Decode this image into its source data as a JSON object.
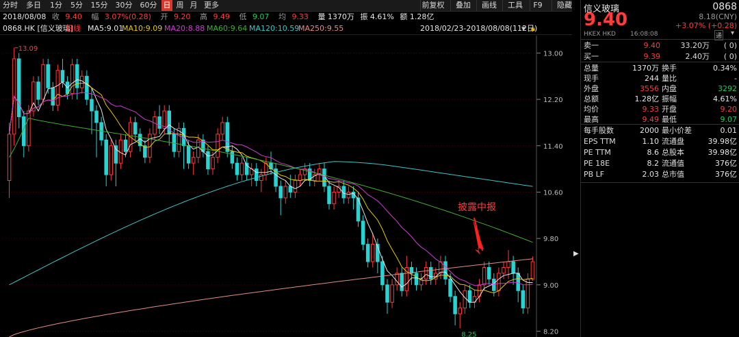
{
  "tabs": [
    "分时",
    "多日",
    "1分",
    "5分",
    "15分",
    "30分",
    "60分",
    "日",
    "周",
    "月",
    "更多"
  ],
  "active_tab": "日",
  "toolbar": [
    "前复权",
    "叠加",
    "画线",
    "工具",
    "F9",
    "隐藏"
  ],
  "info": {
    "date": "2018/08/08",
    "close_label": "收",
    "close": "9.40",
    "change_label": "幅",
    "change": "3.07%(0.28)",
    "open_label": "开",
    "open": "9.20",
    "high_label": "高",
    "high": "9.49",
    "low_label": "低",
    "low": "9.07",
    "avg_label": "均",
    "avg": "9.33",
    "volume": "量 1370万",
    "amplitude": "振 4.61%",
    "amount": "额 1.28亿"
  },
  "ma_bar": {
    "code": "0868.HK [信义玻璃]",
    "period": "日线",
    "ma5": "MA5:9.01",
    "ma10": "MA10:9.09",
    "ma20": "MA20:8.88",
    "ma60": "MA60:9.64",
    "ma120": "MA120:10.59",
    "ma250": "MA250:9.55",
    "range": "2018/02/23-2018/08/08(112日)"
  },
  "colors": {
    "up": "#ff3b3b",
    "down": "#27d3d3",
    "ma5": "#e6e6e6",
    "ma10": "#e8c800",
    "ma20": "#d13ad1",
    "ma60": "#3fae2f",
    "ma120": "#3cc6c6",
    "ma250": "#e28e86"
  },
  "annotation": "披露中报",
  "high_mark": "13.09",
  "low_mark": "8.25",
  "chart_data": {
    "type": "candlestick",
    "y_ticks": [
      "13.00",
      "12.20",
      "11.40",
      "10.60",
      "9.80",
      "9.00",
      "8.20"
    ],
    "ylim": [
      8.1,
      13.3
    ],
    "candles": [
      [
        10.8,
        11.6,
        10.5,
        11.8
      ],
      [
        11.6,
        12.9,
        11.4,
        13.09
      ],
      [
        12.9,
        11.9,
        11.7,
        13.0
      ],
      [
        11.9,
        11.4,
        11.2,
        12.0
      ],
      [
        11.4,
        12.0,
        11.3,
        12.1
      ],
      [
        12.0,
        12.5,
        11.9,
        12.6
      ],
      [
        12.5,
        12.2,
        12.1,
        12.6
      ],
      [
        12.2,
        12.8,
        12.1,
        12.9
      ],
      [
        12.8,
        12.4,
        12.3,
        12.9
      ],
      [
        12.4,
        12.1,
        12.0,
        12.5
      ],
      [
        12.1,
        12.7,
        12.0,
        12.8
      ],
      [
        12.7,
        12.5,
        12.4,
        12.9
      ],
      [
        12.5,
        12.3,
        12.2,
        12.6
      ],
      [
        12.3,
        12.8,
        12.2,
        12.9
      ],
      [
        12.8,
        12.4,
        12.2,
        12.9
      ],
      [
        12.4,
        12.6,
        12.3,
        12.7
      ],
      [
        12.6,
        12.2,
        12.1,
        12.7
      ],
      [
        12.2,
        12.0,
        11.6,
        12.4
      ],
      [
        12.0,
        11.8,
        11.2,
        12.1
      ],
      [
        11.8,
        11.5,
        11.4,
        11.9
      ],
      [
        11.5,
        10.9,
        10.7,
        11.6
      ],
      [
        10.9,
        11.4,
        10.8,
        11.5
      ],
      [
        11.4,
        11.1,
        10.7,
        11.5
      ],
      [
        11.1,
        11.5,
        11.0,
        11.6
      ],
      [
        11.5,
        11.3,
        11.2,
        11.6
      ],
      [
        11.3,
        11.8,
        11.2,
        11.9
      ],
      [
        11.8,
        11.6,
        11.5,
        11.9
      ],
      [
        11.6,
        11.4,
        11.3,
        11.7
      ],
      [
        11.4,
        11.2,
        11.1,
        11.5
      ],
      [
        11.2,
        11.6,
        11.1,
        11.7
      ],
      [
        11.6,
        11.9,
        11.5,
        12.0
      ],
      [
        11.9,
        11.7,
        11.6,
        12.1
      ],
      [
        11.7,
        12.0,
        11.6,
        12.1
      ],
      [
        12.0,
        11.6,
        11.4,
        12.1
      ],
      [
        11.6,
        11.3,
        11.2,
        11.7
      ],
      [
        11.3,
        11.7,
        11.2,
        11.8
      ],
      [
        11.7,
        11.4,
        11.0,
        11.8
      ],
      [
        11.4,
        11.1,
        11.0,
        11.5
      ],
      [
        11.1,
        11.2,
        10.9,
        11.3
      ],
      [
        11.2,
        11.5,
        11.1,
        11.6
      ],
      [
        11.5,
        11.3,
        11.2,
        11.6
      ],
      [
        11.3,
        11.0,
        10.9,
        11.4
      ],
      [
        11.0,
        11.2,
        10.9,
        11.3
      ],
      [
        11.2,
        11.6,
        11.1,
        11.7
      ],
      [
        11.6,
        11.8,
        11.5,
        11.9
      ],
      [
        11.8,
        11.3,
        11.2,
        11.9
      ],
      [
        11.3,
        11.1,
        11.0,
        11.4
      ],
      [
        11.1,
        10.9,
        10.8,
        11.2
      ],
      [
        10.9,
        11.1,
        10.8,
        11.2
      ],
      [
        11.1,
        10.9,
        10.8,
        11.2
      ],
      [
        10.9,
        11.0,
        10.7,
        11.1
      ],
      [
        11.0,
        10.8,
        10.7,
        11.1
      ],
      [
        10.8,
        10.9,
        10.6,
        11.0
      ],
      [
        10.9,
        11.1,
        10.8,
        11.2
      ],
      [
        11.1,
        11.0,
        10.9,
        11.3
      ],
      [
        11.0,
        10.7,
        10.6,
        11.1
      ],
      [
        10.7,
        10.5,
        10.2,
        10.8
      ],
      [
        10.5,
        10.7,
        10.4,
        10.8
      ],
      [
        10.7,
        10.6,
        10.5,
        10.9
      ],
      [
        10.6,
        10.8,
        10.5,
        10.9
      ],
      [
        10.8,
        10.9,
        10.7,
        11.0
      ],
      [
        10.9,
        11.0,
        10.8,
        11.1
      ],
      [
        11.0,
        10.8,
        10.7,
        11.1
      ],
      [
        10.8,
        10.9,
        10.7,
        11.0
      ],
      [
        10.9,
        11.0,
        10.8,
        11.1
      ],
      [
        11.0,
        10.7,
        10.6,
        11.1
      ],
      [
        10.7,
        10.4,
        10.3,
        10.8
      ],
      [
        10.4,
        10.6,
        10.3,
        10.7
      ],
      [
        10.6,
        10.7,
        10.5,
        10.8
      ],
      [
        10.7,
        10.5,
        10.4,
        10.8
      ],
      [
        10.5,
        10.6,
        10.4,
        10.7
      ],
      [
        10.6,
        10.5,
        10.3,
        10.7
      ],
      [
        10.5,
        10.1,
        10.0,
        10.6
      ],
      [
        10.1,
        9.7,
        9.6,
        10.2
      ],
      [
        9.7,
        9.4,
        9.3,
        9.8
      ],
      [
        9.4,
        9.7,
        9.3,
        9.9
      ],
      [
        9.7,
        9.4,
        9.2,
        9.8
      ],
      [
        9.4,
        9.0,
        8.9,
        9.5
      ],
      [
        9.0,
        8.7,
        8.5,
        9.1
      ],
      [
        8.7,
        9.0,
        8.6,
        9.1
      ],
      [
        9.0,
        9.2,
        8.9,
        9.3
      ],
      [
        9.2,
        8.9,
        8.8,
        9.3
      ],
      [
        8.9,
        9.3,
        8.8,
        9.5
      ],
      [
        9.3,
        9.2,
        9.0,
        9.4
      ],
      [
        9.2,
        9.0,
        8.9,
        9.3
      ],
      [
        9.0,
        9.1,
        8.9,
        9.2
      ],
      [
        9.1,
        9.3,
        9.0,
        9.4
      ],
      [
        9.3,
        9.1,
        9.0,
        9.4
      ],
      [
        9.1,
        9.2,
        9.0,
        9.3
      ],
      [
        9.2,
        9.4,
        9.1,
        9.5
      ],
      [
        9.4,
        9.1,
        9.0,
        9.5
      ],
      [
        9.1,
        8.8,
        8.7,
        9.2
      ],
      [
        8.8,
        8.5,
        8.3,
        8.9
      ],
      [
        8.5,
        8.6,
        8.25,
        8.7
      ],
      [
        8.6,
        8.9,
        8.5,
        9.0
      ],
      [
        8.9,
        8.7,
        8.6,
        9.0
      ],
      [
        8.7,
        8.8,
        8.6,
        8.9
      ],
      [
        8.8,
        9.0,
        8.7,
        9.1
      ],
      [
        9.0,
        9.3,
        8.9,
        9.4
      ],
      [
        9.3,
        9.1,
        9.0,
        9.4
      ],
      [
        9.1,
        8.9,
        8.8,
        9.2
      ],
      [
        8.9,
        9.2,
        8.8,
        9.3
      ],
      [
        9.2,
        9.3,
        9.1,
        9.4
      ],
      [
        9.3,
        9.4,
        9.1,
        9.6
      ],
      [
        9.4,
        9.2,
        9.0,
        9.5
      ],
      [
        9.2,
        8.9,
        8.7,
        9.3
      ],
      [
        8.9,
        8.6,
        8.5,
        9.0
      ],
      [
        8.6,
        9.1,
        8.5,
        9.2
      ],
      [
        9.1,
        9.4,
        9.07,
        9.49
      ]
    ]
  },
  "panel": {
    "name": "信义玻璃",
    "code": "0868",
    "price": "9.40",
    "cny": "8.18(CNY)",
    "change": "+3.07% (+0.28)",
    "exchange": "HKEX  HKD",
    "time": "16:08:08",
    "tong": "通",
    "bid_ask": [
      {
        "label": "卖一",
        "price": "9.40",
        "vol": "33.20万",
        "cnt": "( 0)"
      },
      {
        "label": "买一",
        "price": "9.39",
        "vol": "2.40万",
        "cnt": "( 0)"
      }
    ],
    "stats": [
      {
        "l1": "总量",
        "v1": "1370万",
        "c1": "white",
        "l2": "换手",
        "v2": "0.34%",
        "c2": "white"
      },
      {
        "l1": "现手",
        "v1": "244",
        "c1": "white",
        "l2": "量比",
        "v2": "-",
        "c2": "white"
      },
      {
        "l1": "外盘",
        "v1": "3556",
        "c1": "red",
        "l2": "内盘",
        "v2": "3292",
        "c2": "green"
      },
      {
        "l1": "总额",
        "v1": "1.28亿",
        "c1": "white",
        "l2": "振幅",
        "v2": "4.61%",
        "c2": "white"
      },
      {
        "l1": "均价",
        "v1": "9.33",
        "c1": "red",
        "l2": "开盘",
        "v2": "9.20",
        "c2": "red"
      },
      {
        "l1": "最高",
        "v1": "9.49",
        "c1": "red",
        "l2": "最低",
        "v2": "9.07",
        "c2": "green"
      }
    ],
    "fundamentals": [
      {
        "l1": "每手股数",
        "v1": "2000",
        "l2": "最小价差",
        "v2": "0.01"
      },
      {
        "l1": "EPS TTM",
        "v1": "1.10",
        "l2": "流通盘",
        "v2": "39.98亿"
      },
      {
        "l1": "PE TTM",
        "v1": "8.6",
        "l2": "总股本",
        "v2": "39.98亿"
      },
      {
        "l1": "PE 18E",
        "v1": "8.2",
        "l2": "流通值",
        "v2": "376亿"
      },
      {
        "l1": "PB LF",
        "v1": "2.03",
        "l2": "总市值",
        "v2": "376亿"
      }
    ]
  }
}
